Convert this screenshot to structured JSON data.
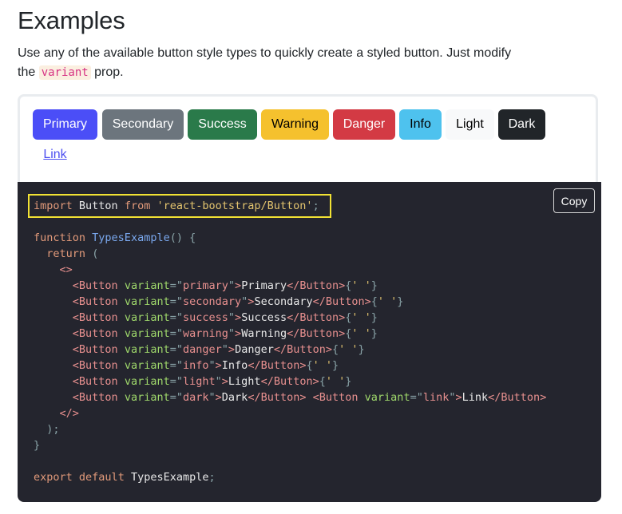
{
  "heading": "Examples",
  "description": {
    "before": "Use any of the available button style types to quickly create a styled button. Just modify the ",
    "code": "variant",
    "after": " prop."
  },
  "buttons": [
    {
      "label": "Primary",
      "variant": "primary"
    },
    {
      "label": "Secondary",
      "variant": "secondary"
    },
    {
      "label": "Success",
      "variant": "success"
    },
    {
      "label": "Warning",
      "variant": "warning"
    },
    {
      "label": "Danger",
      "variant": "danger"
    },
    {
      "label": "Info",
      "variant": "info"
    },
    {
      "label": "Light",
      "variant": "light"
    },
    {
      "label": "Dark",
      "variant": "dark"
    },
    {
      "label": "Link",
      "variant": "link"
    }
  ],
  "copy_label": "Copy",
  "code_lines": [
    "import Button from 'react-bootstrap/Button';",
    "",
    "function TypesExample() {",
    "  return (",
    "    <>",
    "      <Button variant=\"primary\">Primary</Button>{' '}",
    "      <Button variant=\"secondary\">Secondary</Button>{' '}",
    "      <Button variant=\"success\">Success</Button>{' '}",
    "      <Button variant=\"warning\">Warning</Button>{' '}",
    "      <Button variant=\"danger\">Danger</Button>{' '}",
    "      <Button variant=\"info\">Info</Button>{' '}",
    "      <Button variant=\"light\">Light</Button>{' '}",
    "      <Button variant=\"dark\">Dark</Button> <Button variant=\"link\">Link</Button>",
    "    </>",
    "  );",
    "}",
    "",
    "export default TypesExample;"
  ],
  "colors": {
    "primary": "#4b4ef7",
    "secondary": "#6c757d",
    "success": "#2a7a4a",
    "warning": "#f5c12e",
    "danger": "#d33a44",
    "info": "#4ec2ee",
    "light": "#f8f9fa",
    "dark": "#212529",
    "link": "#4c4ef0",
    "code_background": "#24252e",
    "highlight_border": "#f2e234"
  }
}
